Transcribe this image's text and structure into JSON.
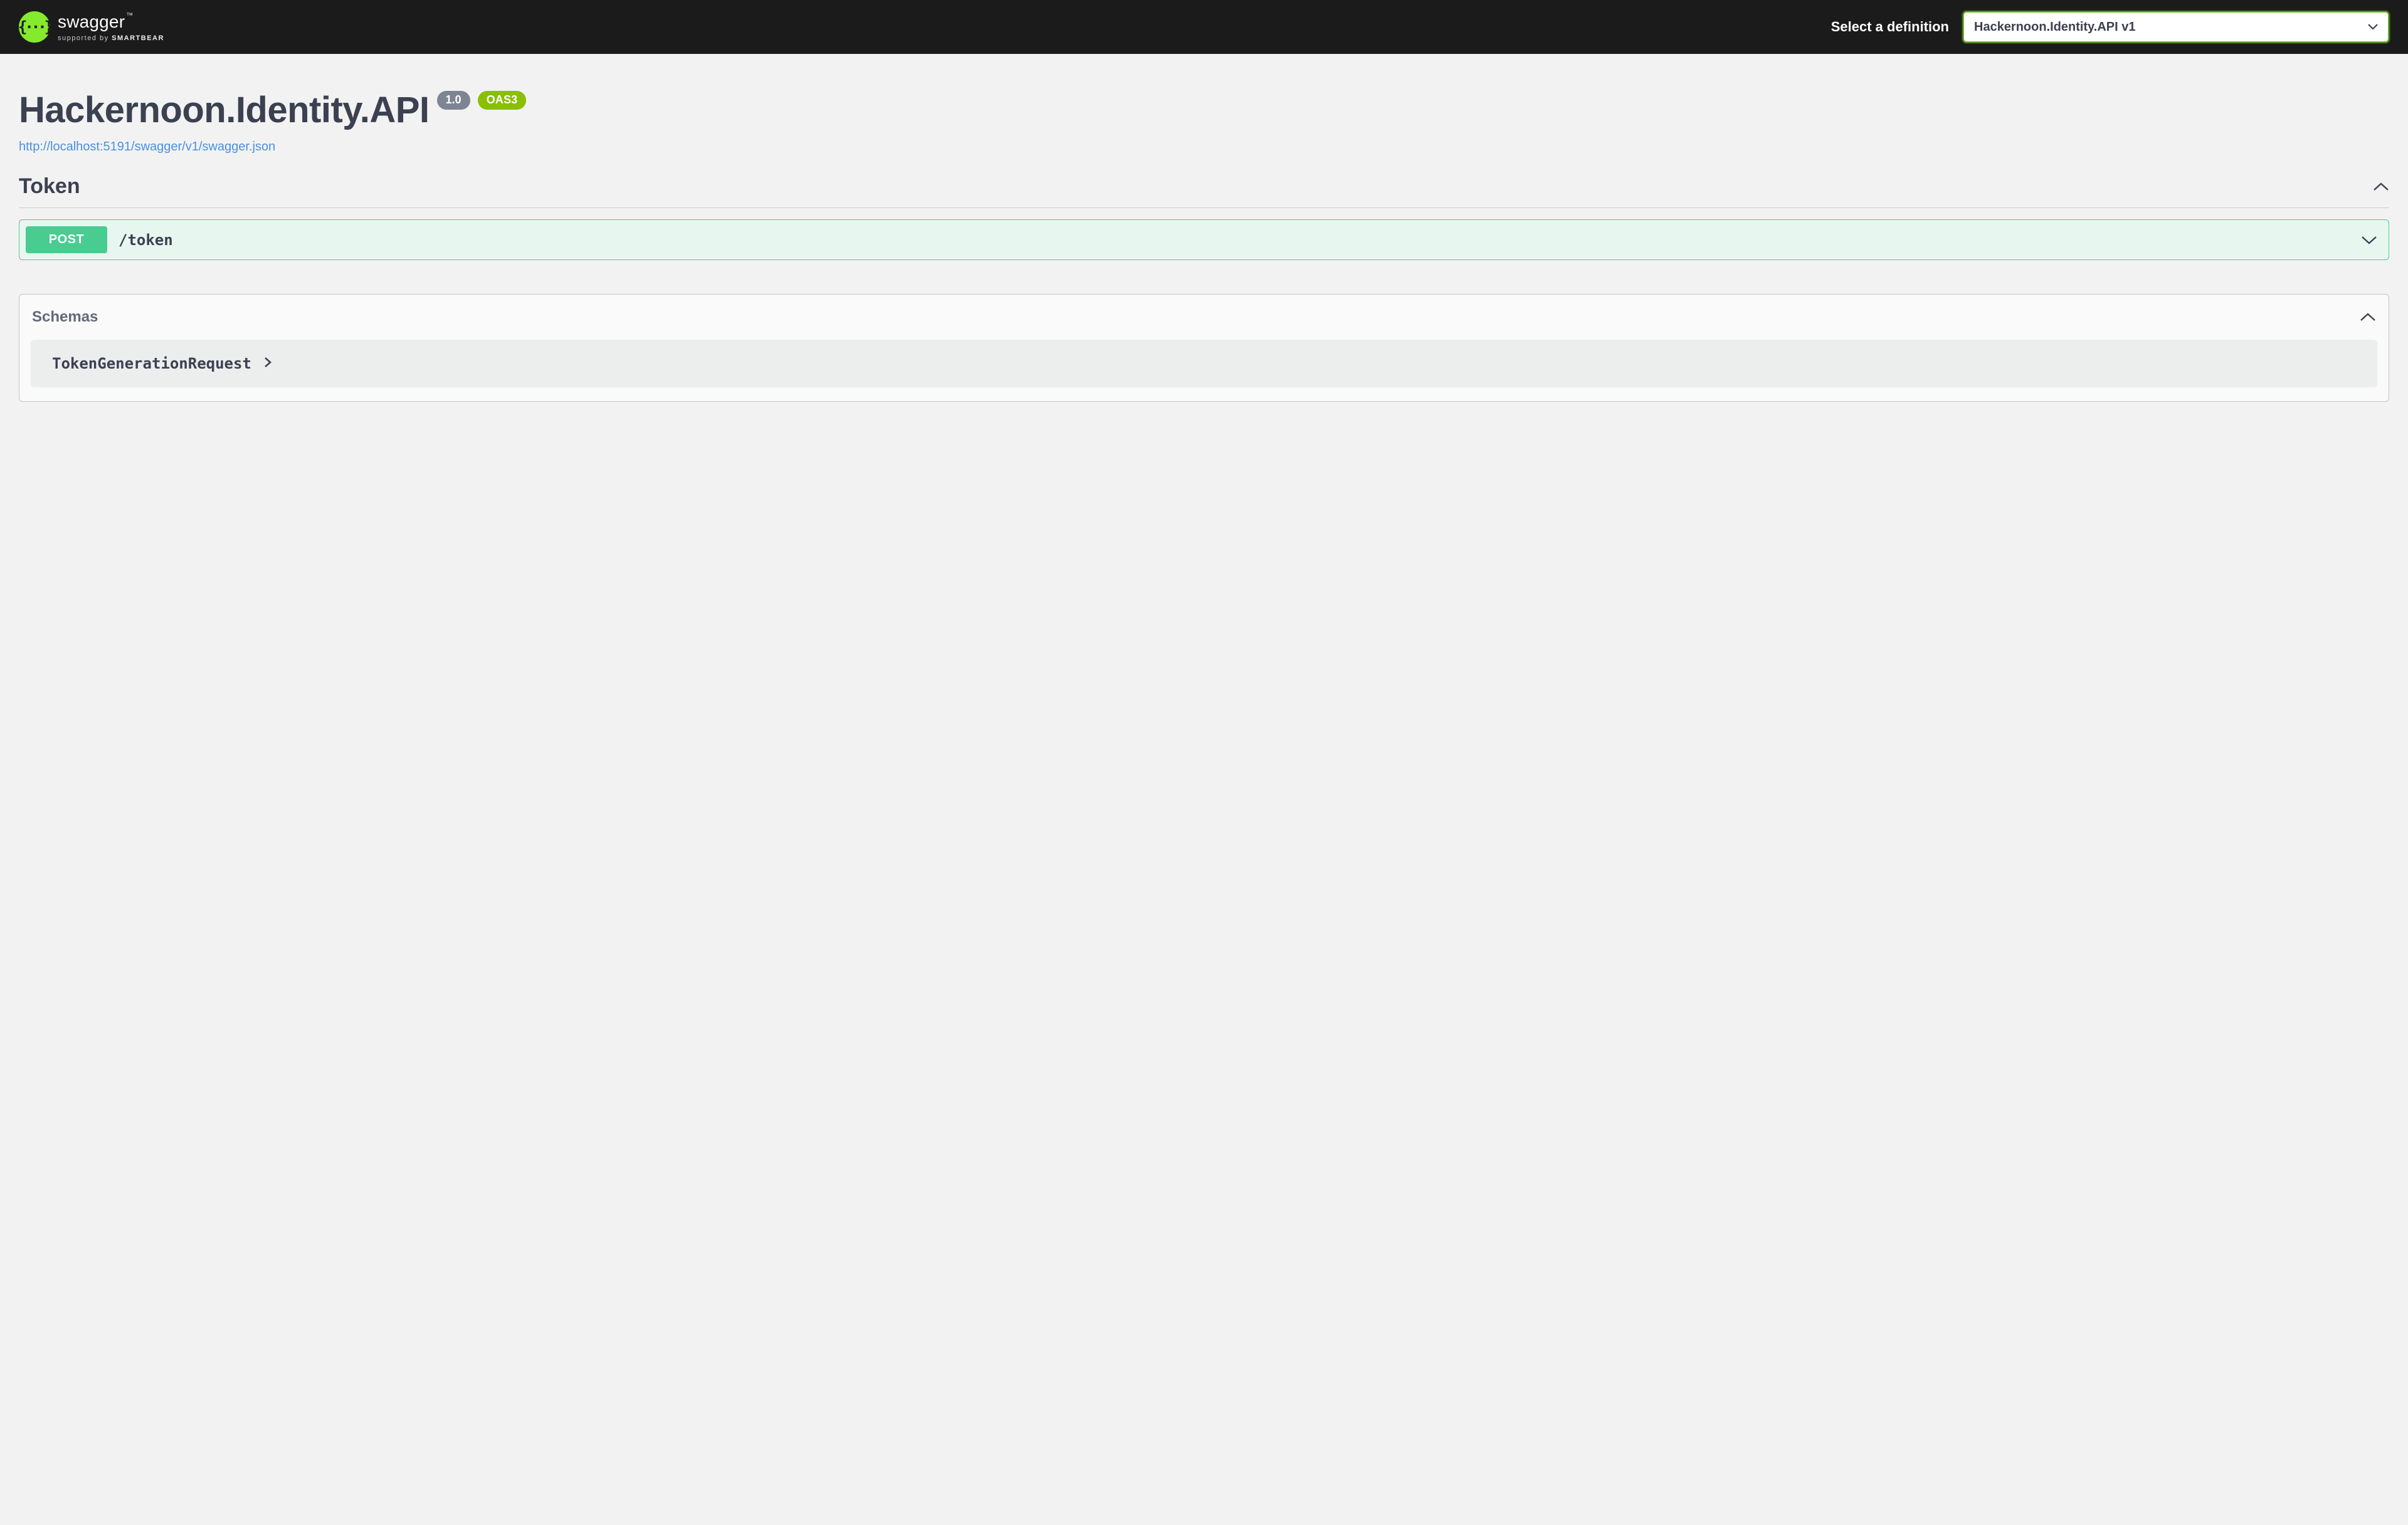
{
  "topbar": {
    "brand": "swagger",
    "brand_tm": "™",
    "supported_prefix": "supported by ",
    "supported_brand": "SMARTBEAR",
    "select_label": "Select a definition",
    "definition_selected": "Hackernoon.Identity.API v1"
  },
  "info": {
    "title": "Hackernoon.Identity.API",
    "version": "1.0",
    "oas_version": "OAS3",
    "spec_url": "http://localhost:5191/swagger/v1/swagger.json"
  },
  "tags": [
    {
      "name": "Token",
      "operations": [
        {
          "method": "POST",
          "path": "/token"
        }
      ]
    }
  ],
  "schemas": {
    "title": "Schemas",
    "items": [
      {
        "name": "TokenGenerationRequest"
      }
    ]
  }
}
